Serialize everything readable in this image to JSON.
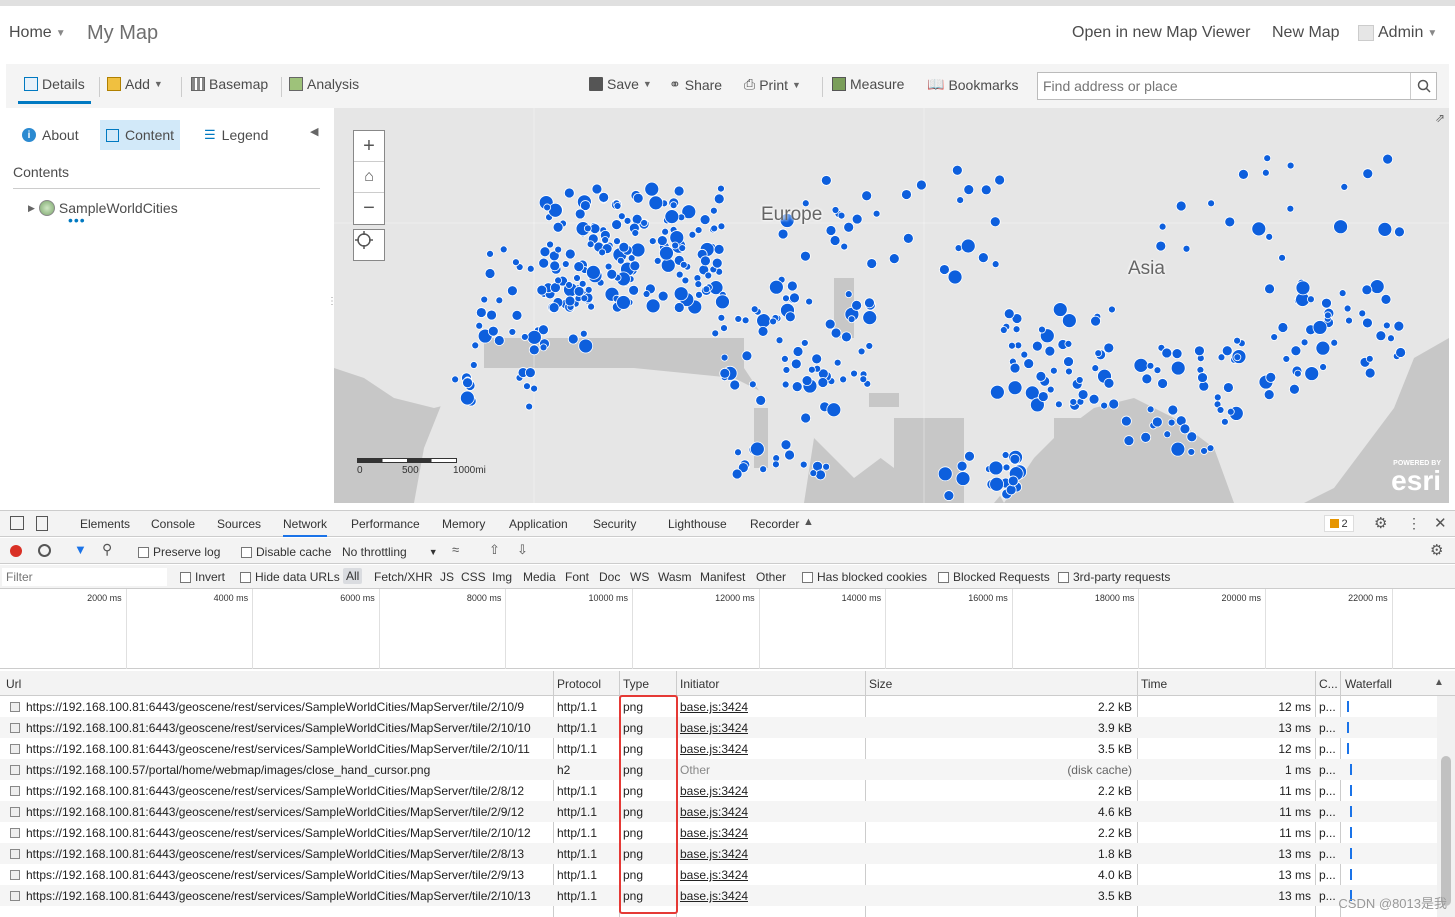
{
  "topnav": {
    "home": "Home",
    "title": "My Map",
    "open_viewer": "Open in new Map Viewer",
    "new_map": "New Map",
    "user": "Admin"
  },
  "toolbar": {
    "details": "Details",
    "add": "Add",
    "basemap": "Basemap",
    "analysis": "Analysis",
    "save": "Save",
    "share": "Share",
    "print": "Print",
    "measure": "Measure",
    "bookmarks": "Bookmarks",
    "search_placeholder": "Find address or place"
  },
  "sidepanel": {
    "tabs": [
      "About",
      "Content",
      "Legend"
    ],
    "contents_label": "Contents",
    "layer_name": "SampleWorldCities"
  },
  "map": {
    "labels": [
      "Europe",
      "Asia"
    ],
    "scale_labels": [
      "0",
      "500",
      "1000mi"
    ],
    "esri_powered": "POWERED BY",
    "esri_brand": "esri"
  },
  "devtools": {
    "tabs": [
      "Elements",
      "Console",
      "Sources",
      "Network",
      "Performance",
      "Memory",
      "Application",
      "Security",
      "Lighthouse",
      "Recorder"
    ],
    "issues_count": "2",
    "preserve_log": "Preserve log",
    "disable_cache": "Disable cache",
    "throttling": "No throttling",
    "filter_placeholder": "Filter",
    "invert": "Invert",
    "hide_data_urls": "Hide data URLs",
    "types": [
      "All",
      "Fetch/XHR",
      "JS",
      "CSS",
      "Img",
      "Media",
      "Font",
      "Doc",
      "WS",
      "Wasm",
      "Manifest",
      "Other"
    ],
    "has_blocked_cookies": "Has blocked cookies",
    "blocked_requests": "Blocked Requests",
    "third_party": "3rd-party requests",
    "timeline_ticks": [
      "2000 ms",
      "4000 ms",
      "6000 ms",
      "8000 ms",
      "10000 ms",
      "12000 ms",
      "14000 ms",
      "16000 ms",
      "18000 ms",
      "20000 ms",
      "22000 ms"
    ],
    "columns": [
      "Url",
      "Protocol",
      "Type",
      "Initiator",
      "Size",
      "Time",
      "C...",
      "Waterfall"
    ],
    "rows": [
      {
        "url": "https://192.168.100.81:6443/geoscene/rest/services/SampleWorldCities/MapServer/tile/2/10/9",
        "protocol": "http/1.1",
        "type": "png",
        "initiator": "base.js:3424",
        "size": "2.2 kB",
        "time": "12 ms",
        "c": "p..."
      },
      {
        "url": "https://192.168.100.81:6443/geoscene/rest/services/SampleWorldCities/MapServer/tile/2/10/10",
        "protocol": "http/1.1",
        "type": "png",
        "initiator": "base.js:3424",
        "size": "3.9 kB",
        "time": "13 ms",
        "c": "p..."
      },
      {
        "url": "https://192.168.100.81:6443/geoscene/rest/services/SampleWorldCities/MapServer/tile/2/10/11",
        "protocol": "http/1.1",
        "type": "png",
        "initiator": "base.js:3424",
        "size": "3.5 kB",
        "time": "12 ms",
        "c": "p..."
      },
      {
        "url": "https://192.168.100.57/portal/home/webmap/images/close_hand_cursor.png",
        "protocol": "h2",
        "type": "png",
        "initiator": "Other",
        "size": "(disk cache)",
        "time": "1 ms",
        "c": "p..."
      },
      {
        "url": "https://192.168.100.81:6443/geoscene/rest/services/SampleWorldCities/MapServer/tile/2/8/12",
        "protocol": "http/1.1",
        "type": "png",
        "initiator": "base.js:3424",
        "size": "2.2 kB",
        "time": "11 ms",
        "c": "p..."
      },
      {
        "url": "https://192.168.100.81:6443/geoscene/rest/services/SampleWorldCities/MapServer/tile/2/9/12",
        "protocol": "http/1.1",
        "type": "png",
        "initiator": "base.js:3424",
        "size": "4.6 kB",
        "time": "11 ms",
        "c": "p..."
      },
      {
        "url": "https://192.168.100.81:6443/geoscene/rest/services/SampleWorldCities/MapServer/tile/2/10/12",
        "protocol": "http/1.1",
        "type": "png",
        "initiator": "base.js:3424",
        "size": "2.2 kB",
        "time": "11 ms",
        "c": "p..."
      },
      {
        "url": "https://192.168.100.81:6443/geoscene/rest/services/SampleWorldCities/MapServer/tile/2/8/13",
        "protocol": "http/1.1",
        "type": "png",
        "initiator": "base.js:3424",
        "size": "1.8 kB",
        "time": "13 ms",
        "c": "p..."
      },
      {
        "url": "https://192.168.100.81:6443/geoscene/rest/services/SampleWorldCities/MapServer/tile/2/9/13",
        "protocol": "http/1.1",
        "type": "png",
        "initiator": "base.js:3424",
        "size": "4.0 kB",
        "time": "13 ms",
        "c": "p..."
      },
      {
        "url": "https://192.168.100.81:6443/geoscene/rest/services/SampleWorldCities/MapServer/tile/2/10/13",
        "protocol": "http/1.1",
        "type": "png",
        "initiator": "base.js:3424",
        "size": "3.5 kB",
        "time": "13 ms",
        "c": "p..."
      }
    ]
  },
  "watermark": "CSDN @8013是我",
  "colors": {
    "accent": "#0079c1",
    "city_dot": "#0d5fdd",
    "highlight": "#e53935"
  }
}
